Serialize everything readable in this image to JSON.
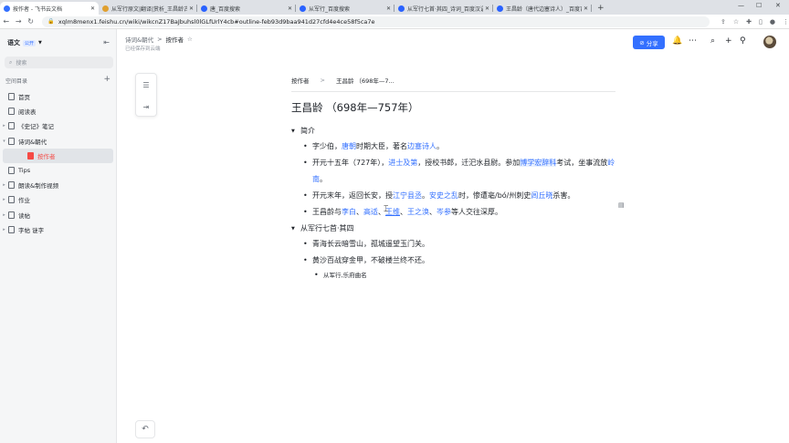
{
  "browser": {
    "tabs": [
      {
        "title": "按作者 - 飞书云文档",
        "fav": "#3370ff"
      },
      {
        "title": "从军行原文|翻译|赏析_王昌龄古诗",
        "fav": "#e0a030"
      },
      {
        "title": "唐_百度搜索",
        "fav": "#2a62ff"
      },
      {
        "title": "从军行_百度搜索",
        "fav": "#2a62ff"
      },
      {
        "title": "从军行七首·其四_诗词_百度汉语",
        "fav": "#2a62ff"
      },
      {
        "title": "王昌龄（唐代边塞诗人）_百度百科",
        "fav": "#2a62ff"
      }
    ],
    "new_tab": "+",
    "url": "xqlm8menx1.feishu.cn/wiki/wikcnZ17BaJbuhsl0lGLfUrlY4cb#outline-feb93d9baa941d27cfd4e4ce58f5ca7e"
  },
  "sidebar": {
    "workspace": "语文",
    "badge": "公开",
    "search_placeholder": "搜索",
    "section": "空间目录",
    "items": [
      {
        "label": "首页",
        "arrow": "",
        "indent": 0
      },
      {
        "label": "阅读表",
        "arrow": "",
        "indent": 0
      },
      {
        "label": "《史记》笔记",
        "arrow": "▸",
        "indent": 0
      },
      {
        "label": "诗词&朝代",
        "arrow": "▾",
        "indent": 0
      },
      {
        "label": "按作者",
        "arrow": "",
        "indent": 1,
        "selected": true
      },
      {
        "label": "Tips",
        "arrow": "",
        "indent": 0
      },
      {
        "label": "朗读&制作视频",
        "arrow": "▸",
        "indent": 0
      },
      {
        "label": "作业",
        "arrow": "▸",
        "indent": 0
      },
      {
        "label": "读帖",
        "arrow": "▸",
        "indent": 0
      },
      {
        "label": "字帖 谜字",
        "arrow": "▸",
        "indent": 0
      }
    ]
  },
  "header": {
    "crumb_parent": "诗词&朝代",
    "crumb_sep": ">",
    "crumb_current": "按作者",
    "star": "☆",
    "saved": "已经保存到云端",
    "share": "分享"
  },
  "doc": {
    "crumb_a": "按作者",
    "crumb_sep": ">",
    "crumb_b": "王昌龄 （698年—7...",
    "title": "王昌龄 （698年—757年）",
    "h1": "简介",
    "b1": [
      "字少伯，",
      "唐朝",
      "时期大臣，著名",
      "边塞诗人",
      "。"
    ],
    "b2": [
      "开元十五年（727年），",
      "进士及第",
      "，授校书郎，迁汜水县尉。参加",
      "博学宏辞科",
      "考试，坐事流放",
      "岭南",
      "。"
    ],
    "b3": [
      "开元末年，返回长安，授",
      "江宁县丞",
      "。",
      "安史之乱",
      "时，惨遭亳/bó/州刺史",
      "闾丘晓",
      "杀害。"
    ],
    "b4": [
      "王昌龄与",
      "李白",
      "、",
      "高适",
      "、",
      "王维",
      "、",
      "王之涣",
      "、",
      "岑参",
      "等人交往深厚。"
    ],
    "h2": "从军行七首·其四",
    "b5": "青海长云暗雪山，孤城遥望玉门关。",
    "b6": "黄沙百战穿金甲，不破楼兰终不还。",
    "b7": "从军行,乐府曲名"
  }
}
